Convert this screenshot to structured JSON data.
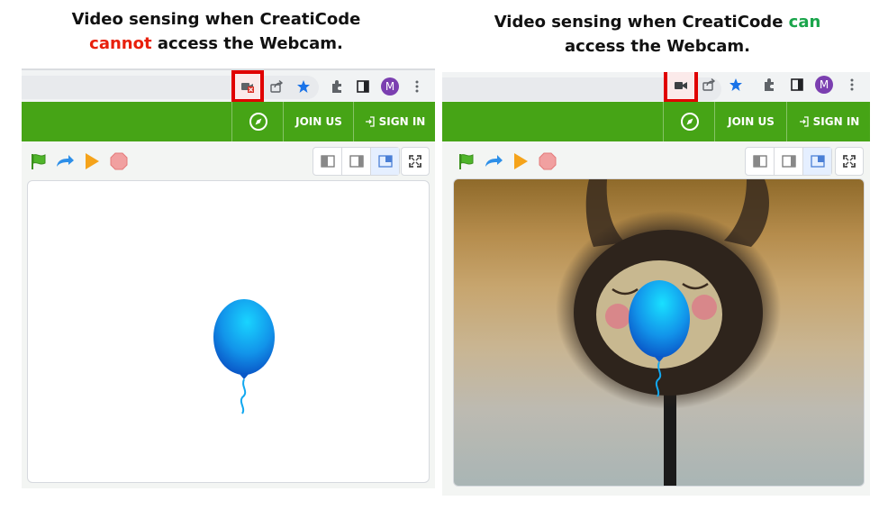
{
  "captions": {
    "left": {
      "line1": "Video sensing when CreatiCode",
      "emphasis": "cannot",
      "line2_rest": " access the Webcam."
    },
    "right": {
      "line1_prefix": "Video sensing when CreatiCode ",
      "emphasis": "can",
      "line2": "access the Webcam."
    }
  },
  "browser": {
    "left": {
      "camera_icon": "camera-blocked-icon",
      "avatar_letter": "M"
    },
    "right": {
      "camera_icon": "camera-icon",
      "avatar_letter": "M"
    }
  },
  "nav": {
    "join_label": "JOIN US",
    "signin_label": "SIGN IN"
  },
  "colors": {
    "accent_green": "#46a416",
    "highlight_red": "#e00000",
    "caption_red": "#e8200c",
    "caption_green": "#1aa54b",
    "avatar_purple": "#7b3fb0",
    "balloon_blue": "#1e88e5"
  }
}
